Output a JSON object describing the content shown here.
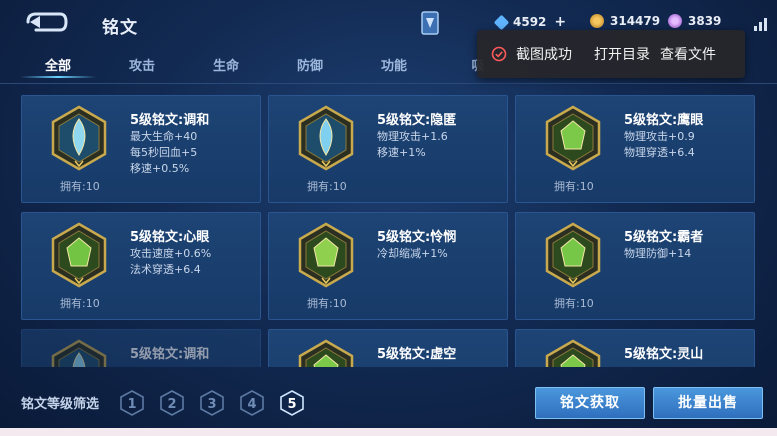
{
  "header": {
    "title": "铭文",
    "currency": [
      {
        "value": "4592",
        "color": "#5fb4ff",
        "icon": "diamond-coupon-icon",
        "has_plus": true
      },
      {
        "value": "314479",
        "color": "#e0a33b",
        "icon": "gold-coin-icon",
        "has_plus": false
      },
      {
        "value": "3839",
        "color": "#c07be8",
        "icon": "crystal-icon",
        "has_plus": false
      }
    ]
  },
  "tabs": [
    {
      "label": "全部",
      "active": true
    },
    {
      "label": "攻击",
      "active": false
    },
    {
      "label": "生命",
      "active": false
    },
    {
      "label": "防御",
      "active": false
    },
    {
      "label": "功能",
      "active": false
    },
    {
      "label": "吸",
      "active": false
    }
  ],
  "toast": {
    "message": "截图成功",
    "action_open_dir": "打开目录",
    "action_view_file": "查看文件"
  },
  "runes": [
    {
      "name": "5级铭文:调和",
      "stats": [
        "最大生命+40",
        "每5秒回血+5",
        "移速+0.5%"
      ],
      "owned": "拥有:10",
      "gem": "blue",
      "gem_color": "#8fd8f0"
    },
    {
      "name": "5级铭文:隐匿",
      "stats": [
        "物理攻击+1.6",
        "移速+1%"
      ],
      "owned": "拥有:10",
      "gem": "blue",
      "gem_color": "#7fd0ef"
    },
    {
      "name": "5级铭文:鹰眼",
      "stats": [
        "物理攻击+0.9",
        "物理穿透+6.4"
      ],
      "owned": "拥有:10",
      "gem": "green",
      "gem_color": "#7cc94a"
    },
    {
      "name": "5级铭文:心眼",
      "stats": [
        "攻击速度+0.6%",
        "法术穿透+6.4"
      ],
      "owned": "拥有:10",
      "gem": "green",
      "gem_color": "#74c444"
    },
    {
      "name": "5级铭文:怜悯",
      "stats": [
        "冷却缩减+1%"
      ],
      "owned": "拥有:10",
      "gem": "green",
      "gem_color": "#8fd14e"
    },
    {
      "name": "5级铭文:霸者",
      "stats": [
        "物理防御+14"
      ],
      "owned": "拥有:10",
      "gem": "green",
      "gem_color": "#76c647"
    },
    {
      "name": "5级铭文:调和",
      "stats": [],
      "owned": "",
      "gem": "blue",
      "gem_color": "#8fd8f0"
    },
    {
      "name": "5级铭文:虚空",
      "stats": [],
      "owned": "",
      "gem": "green",
      "gem_color": "#7cc94a"
    },
    {
      "name": "5级铭文:灵山",
      "stats": [],
      "owned": "",
      "gem": "green",
      "gem_color": "#7cc94a"
    }
  ],
  "footer": {
    "filter_label": "铭文等级筛选",
    "levels": [
      {
        "label": "1",
        "selected": false
      },
      {
        "label": "2",
        "selected": false
      },
      {
        "label": "3",
        "selected": false
      },
      {
        "label": "4",
        "selected": false
      },
      {
        "label": "5",
        "selected": true
      }
    ],
    "obtain_button": "铭文获取",
    "sell_button": "批量出售"
  }
}
